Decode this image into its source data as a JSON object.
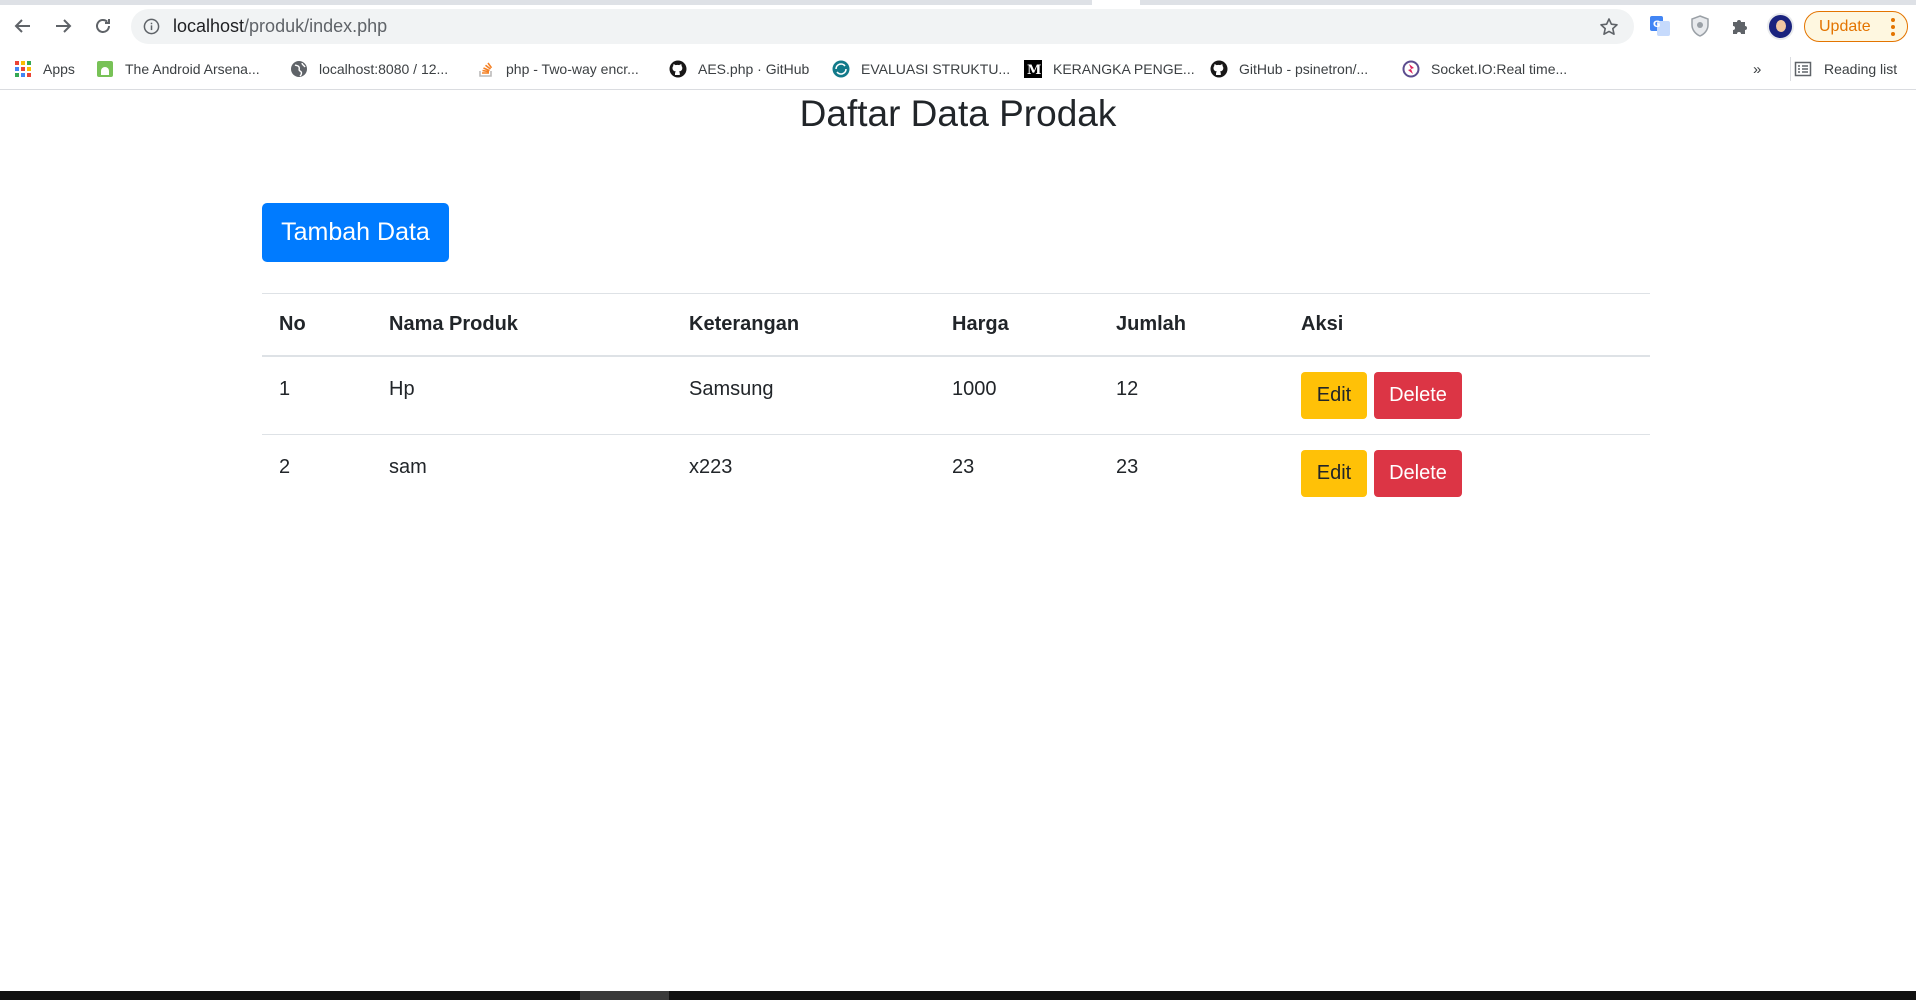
{
  "browser": {
    "url_host": "localhost",
    "url_path": "/produk/index.php",
    "update_label": "Update",
    "bookmarks": [
      {
        "label": "Apps",
        "icon": "apps-grid-icon"
      },
      {
        "label": "The Android Arsena...",
        "icon": "android-icon"
      },
      {
        "label": "localhost:8080 / 12...",
        "icon": "globe-icon"
      },
      {
        "label": "php - Two-way encr...",
        "icon": "stackoverflow-icon"
      },
      {
        "label": "AES.php · GitHub",
        "icon": "github-icon"
      },
      {
        "label": "EVALUASI STRUKTU...",
        "icon": "teal-circle-icon"
      },
      {
        "label": "KERANGKA PENGE...",
        "icon": "medium-icon"
      },
      {
        "label": "GitHub - psinetron/...",
        "icon": "github-icon"
      },
      {
        "label": "Socket.IO:Real time...",
        "icon": "socketio-icon"
      }
    ],
    "more_label": "»",
    "reading_list_label": "Reading list"
  },
  "page": {
    "title": "Daftar Data Prodak",
    "add_button_label": "Tambah Data"
  },
  "table": {
    "headers": [
      "No",
      "Nama Produk",
      "Keterangan",
      "Harga",
      "Jumlah",
      "Aksi"
    ],
    "rows": [
      {
        "no": "1",
        "nama": "Hp",
        "keterangan": "Samsung",
        "harga": "1000",
        "jumlah": "12",
        "edit": "Edit",
        "delete": "Delete"
      },
      {
        "no": "2",
        "nama": "sam",
        "keterangan": "x223",
        "harga": "23",
        "jumlah": "23",
        "edit": "Edit",
        "delete": "Delete"
      }
    ]
  },
  "colors": {
    "primary": "#007bff",
    "warning": "#ffc107",
    "danger": "#dc3545"
  }
}
